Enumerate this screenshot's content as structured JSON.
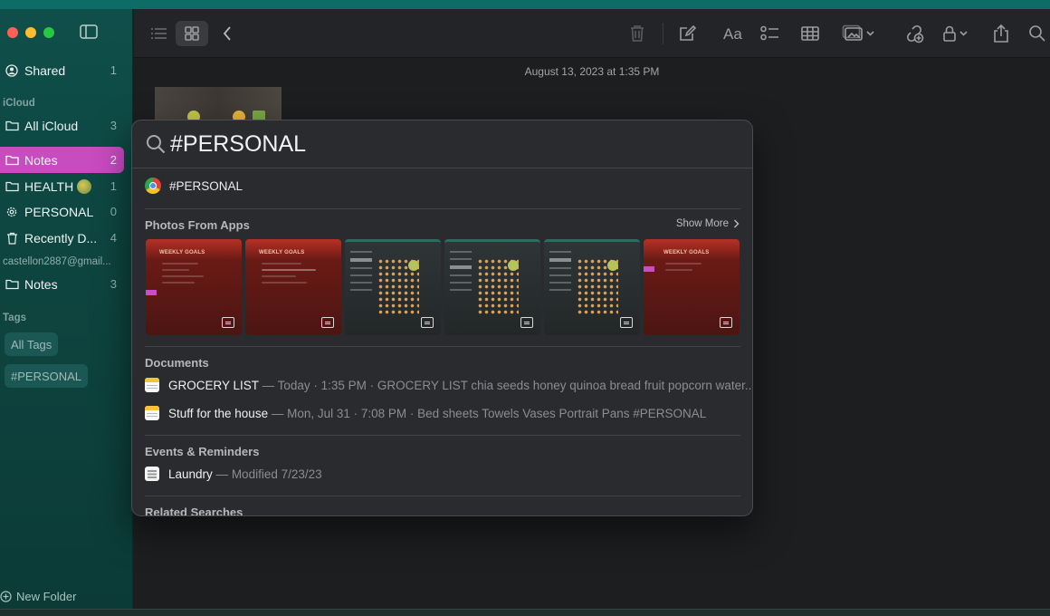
{
  "window": {
    "traffic_lights": [
      "close",
      "minimize",
      "zoom"
    ]
  },
  "sidebar": {
    "shared": {
      "label": "Shared",
      "count": "1",
      "icon": "person-circle-icon"
    },
    "icloud_header": "iCloud",
    "icloud_items": [
      {
        "label": "All iCloud",
        "count": "3",
        "icon": "folder-icon"
      },
      {
        "label": "Notes",
        "count": "2",
        "icon": "folder-icon",
        "selected": true
      },
      {
        "label": "HEALTH",
        "count": "1",
        "icon": "folder-icon"
      },
      {
        "label": "PERSONAL",
        "count": "0",
        "icon": "gear-icon"
      },
      {
        "label": "Recently D...",
        "count": "4",
        "icon": "trash-icon"
      }
    ],
    "account_header": "castellon2887@gmail...",
    "account_items": [
      {
        "label": "Notes",
        "count": "3",
        "icon": "folder-icon"
      }
    ],
    "tags_header": "Tags",
    "tags": [
      "All Tags",
      "#PERSONAL"
    ],
    "new_folder": "New Folder",
    "accent": "#c64cc0"
  },
  "toolbar": {
    "font_button": "Aa"
  },
  "note": {
    "date": "August 13, 2023 at 1:35 PM"
  },
  "spotlight": {
    "query": "#PERSONAL",
    "top_hit": {
      "label": "#PERSONAL",
      "icon": "chrome-icon"
    },
    "photos_title": "Photos From Apps",
    "show_more": "Show More",
    "photos": [
      {
        "style": "red",
        "title": "WEEKLY GOALS"
      },
      {
        "style": "red",
        "title": "WEEKLY GOALS"
      },
      {
        "style": "dark",
        "title": ""
      },
      {
        "style": "dark",
        "title": ""
      },
      {
        "style": "dark",
        "title": ""
      },
      {
        "style": "red",
        "title": "WEEKLY GOALS"
      }
    ],
    "documents_title": "Documents",
    "documents": [
      {
        "name": "GROCERY LIST",
        "meta": "— Today · 1:35 PM · GROCERY LIST chia seeds honey quinoa bread fruit popcorn water..."
      },
      {
        "name": "Stuff for the house",
        "meta": "— Mon, Jul 31 · 7:08 PM · Bed sheets Towels Vases Portrait Pans #PERSONAL"
      }
    ],
    "events_title": "Events & Reminders",
    "events": [
      {
        "name": "Laundry",
        "meta": "— Modified 7/23/23"
      }
    ],
    "related_title": "Related Searches"
  }
}
